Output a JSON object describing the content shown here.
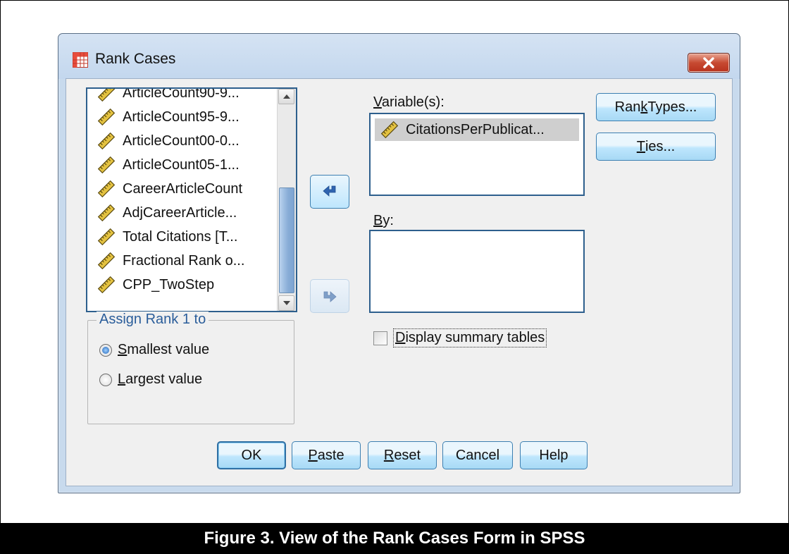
{
  "window": {
    "title": "Rank Cases"
  },
  "source_list": {
    "items": [
      "ArticleCount90-9...",
      "ArticleCount95-9...",
      "ArticleCount00-0...",
      "ArticleCount05-1...",
      "CareerArticleCount",
      "AdjCareerArticle...",
      "Total Citations [T...",
      "Fractional Rank o...",
      "CPP_TwoStep"
    ],
    "variable_icon": "ruler-scale-icon"
  },
  "variables": {
    "label_u": "V",
    "label_rest": "ariable(s):",
    "items": [
      "CitationsPerPublicat..."
    ]
  },
  "by": {
    "label_u": "B",
    "label_rest": "y:"
  },
  "display_summary": {
    "label_u": "D",
    "label_rest": "isplay summary tables",
    "checked": false
  },
  "assign_rank": {
    "title": "Assign Rank 1 to",
    "options": [
      {
        "label_u": "S",
        "label_rest": "mallest value",
        "selected": true
      },
      {
        "label_u": "L",
        "label_rest": "argest value",
        "selected": false
      }
    ]
  },
  "side_buttons": {
    "rank_types": {
      "pre": "Ran",
      "u": "k",
      "post": " Types..."
    },
    "ties": {
      "u": "T",
      "post": "ies..."
    }
  },
  "bottom_buttons": {
    "ok": "OK",
    "paste": {
      "u": "P",
      "post": "aste"
    },
    "reset": {
      "u": "R",
      "post": "eset"
    },
    "cancel": "Cancel",
    "help": "Help"
  },
  "caption": "Figure 3. View of the Rank Cases Form in SPSS",
  "colors": {
    "dialog_bg": "#c8daed",
    "client_bg": "#f0f0f0",
    "close_red": "#c74a32",
    "group_title_blue": "#2a5d9a",
    "caption_bg": "#000000"
  }
}
